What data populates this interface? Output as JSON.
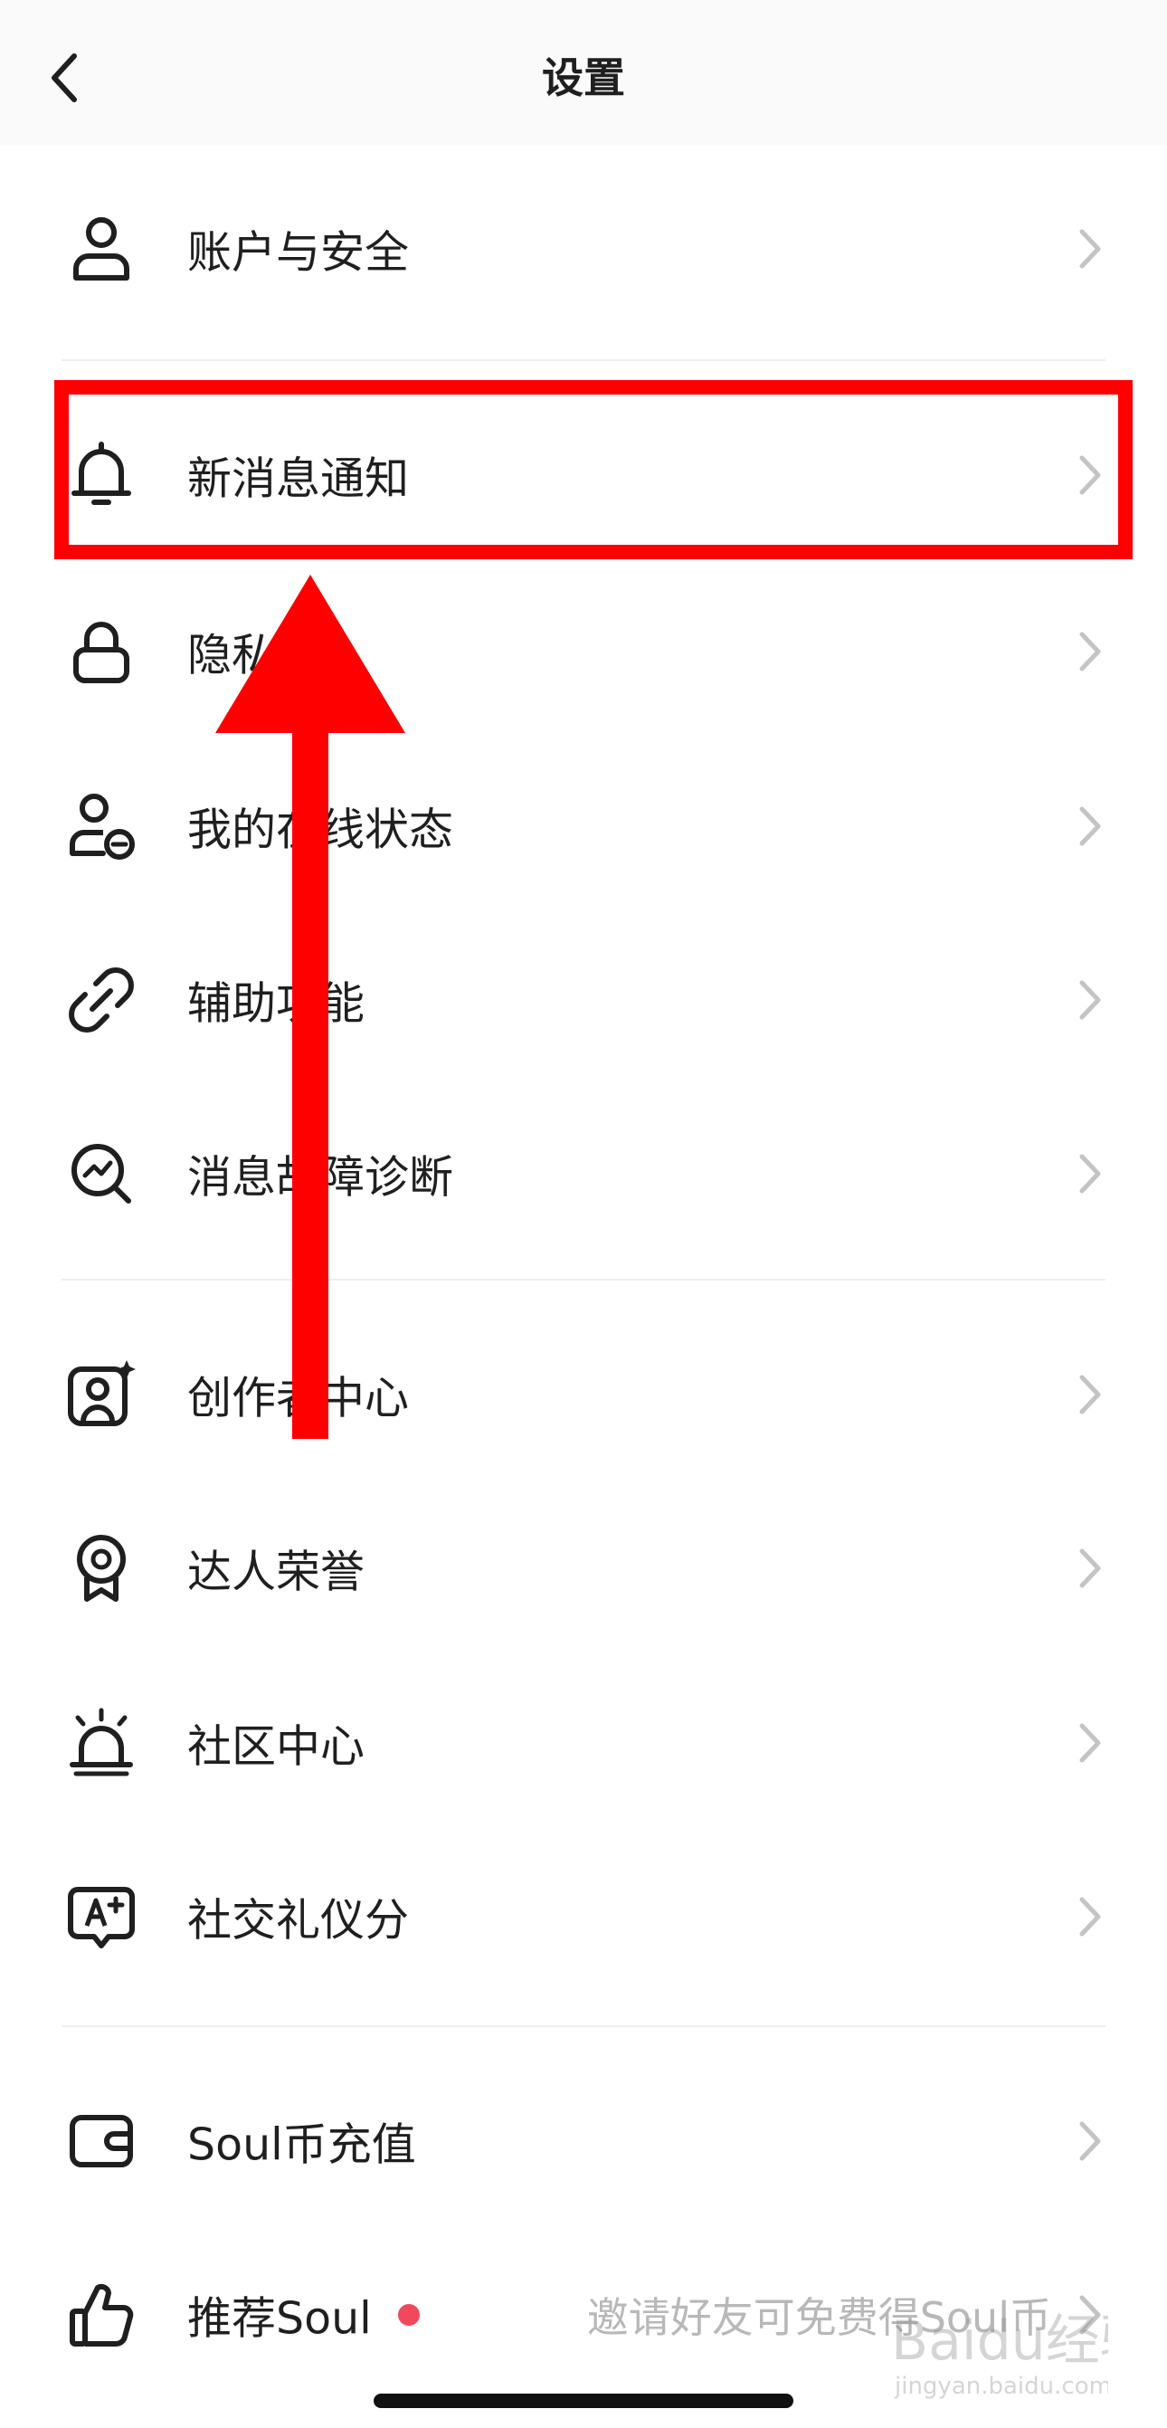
{
  "header": {
    "title": "设置",
    "back_icon": "chevron-left-icon"
  },
  "rows": [
    {
      "label": "账户与安全",
      "icon": "person-icon"
    },
    {
      "label": "新消息通知",
      "icon": "bell-icon"
    },
    {
      "label": "隐私",
      "icon": "lock-icon"
    },
    {
      "label": "我的在线状态",
      "icon": "person-status-icon"
    },
    {
      "label": "辅助功能",
      "icon": "link-icon"
    },
    {
      "label": "消息故障诊断",
      "icon": "diagnosis-search-icon"
    },
    {
      "label": "创作者中心",
      "icon": "creator-portrait-icon"
    },
    {
      "label": "达人荣誉",
      "icon": "badge-medal-icon"
    },
    {
      "label": "社区中心",
      "icon": "siren-icon"
    },
    {
      "label": "社交礼仪分",
      "icon": "etiquette-score-icon"
    },
    {
      "label": "Soul币充值",
      "icon": "wallet-icon"
    },
    {
      "label": "推荐Soul",
      "icon": "thumbs-up-icon",
      "note": "邀请好友可免费得Soul币",
      "has_dot": true
    }
  ],
  "annotation": {
    "highlight_color": "#ff0000",
    "highlighted_item": "新消息通知"
  },
  "watermark": {
    "text": "Baidu经验",
    "subtext": "jingyan.baidu.com"
  },
  "colors": {
    "badge_dot": "#f0485c",
    "chevron": "#c4c4c4",
    "note_text": "#b8b8b8"
  }
}
